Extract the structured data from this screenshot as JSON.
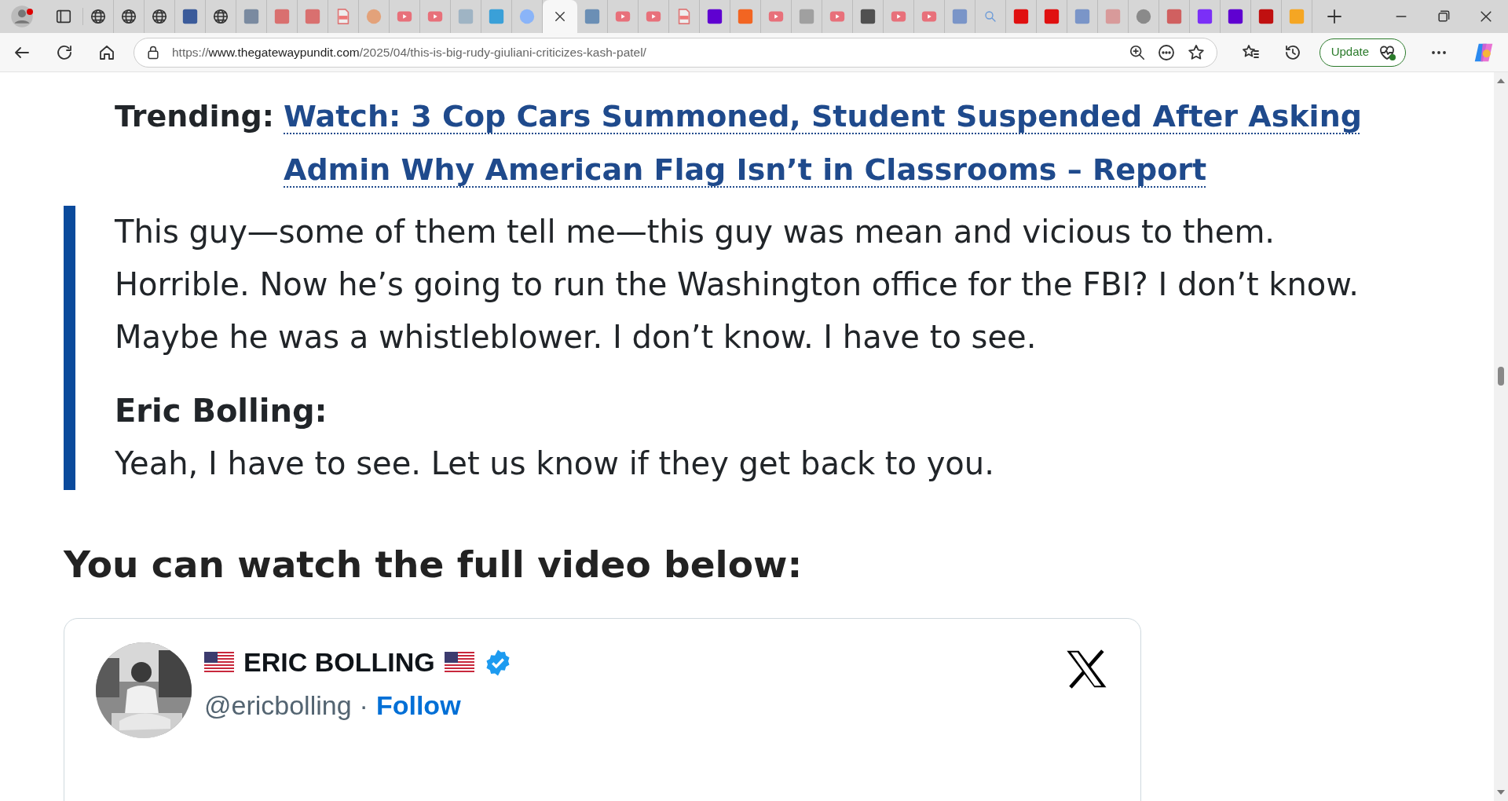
{
  "browser": {
    "tabs": [
      {
        "kind": "globe",
        "selected": false
      },
      {
        "kind": "globe",
        "selected": false
      },
      {
        "kind": "globe",
        "selected": false
      },
      {
        "kind": "square",
        "color": "#3b5b9a",
        "selected": false
      },
      {
        "kind": "globe",
        "selected": false
      },
      {
        "kind": "square",
        "color": "#7a8aa0",
        "selected": false
      },
      {
        "kind": "square",
        "color": "#d9706f",
        "selected": false
      },
      {
        "kind": "square",
        "color": "#d9706f",
        "selected": false
      },
      {
        "kind": "pdf",
        "selected": false
      },
      {
        "kind": "circle",
        "color": "#e3a27a",
        "selected": false
      },
      {
        "kind": "video",
        "selected": false
      },
      {
        "kind": "video",
        "selected": false
      },
      {
        "kind": "square",
        "color": "#9fb4c4",
        "selected": false
      },
      {
        "kind": "square",
        "color": "#3aa0d8",
        "selected": false
      },
      {
        "kind": "circle",
        "color": "#8ab4f8",
        "selected": false
      },
      {
        "selected": true
      },
      {
        "kind": "square",
        "color": "#6b8fb5",
        "selected": false
      },
      {
        "kind": "video",
        "selected": false
      },
      {
        "kind": "video",
        "selected": false
      },
      {
        "kind": "pdf",
        "selected": false
      },
      {
        "kind": "square",
        "color": "#5f01d1",
        "selected": false
      },
      {
        "kind": "square",
        "color": "#f26522",
        "selected": false
      },
      {
        "kind": "video",
        "selected": false
      },
      {
        "kind": "square",
        "color": "#a0a0a0",
        "selected": false
      },
      {
        "kind": "video",
        "selected": false
      },
      {
        "kind": "square",
        "color": "#505050",
        "selected": false
      },
      {
        "kind": "video",
        "selected": false
      },
      {
        "kind": "video",
        "selected": false
      },
      {
        "kind": "square",
        "color": "#7a95c8",
        "selected": false
      },
      {
        "kind": "search",
        "selected": false
      },
      {
        "kind": "square",
        "color": "#e01010",
        "selected": false
      },
      {
        "kind": "square",
        "color": "#e01010",
        "selected": false
      },
      {
        "kind": "square",
        "color": "#7a95c8",
        "selected": false
      },
      {
        "kind": "square",
        "color": "#d89a9a",
        "selected": false
      },
      {
        "kind": "circle",
        "color": "#8a8a8a",
        "selected": false
      },
      {
        "kind": "square",
        "color": "#d06060",
        "selected": false
      },
      {
        "kind": "square",
        "color": "#7b2ff7",
        "selected": false
      },
      {
        "kind": "square",
        "color": "#5f01d1",
        "selected": false
      },
      {
        "kind": "square",
        "color": "#c01010",
        "selected": false
      },
      {
        "kind": "square",
        "color": "#f5a623",
        "selected": false
      }
    ],
    "url": {
      "scheme": "https://",
      "domain": "www.thegatewaypundit.com",
      "path": "/2025/04/this-is-big-rudy-giuliani-criticizes-kash-patel/"
    },
    "update_button": "Update"
  },
  "article": {
    "trending_label": "Trending:",
    "trending_link": "Watch: 3 Cop Cars Summoned, Student Suspended After Asking Admin Why American Flag Isn’t in Classrooms – Report",
    "quote": [
      {
        "kind": "paragraph",
        "text": "This guy—some of them tell me—this guy was mean and vicious to them. Horrible. Now he’s going to run the Washington office for the FBI? I don’t know. Maybe he was a whistleblower. I don’t know. I have to see."
      },
      {
        "kind": "speaker",
        "text": "Eric Bolling:"
      },
      {
        "kind": "paragraph",
        "text": "Yeah, I have to see. Let us know if they get back to you."
      }
    ],
    "heading": "You can watch the full video below:",
    "tweet": {
      "name": "ERIC BOLLING",
      "verified": true,
      "handle": "@ericbolling",
      "separator": "·",
      "follow": "Follow"
    }
  }
}
